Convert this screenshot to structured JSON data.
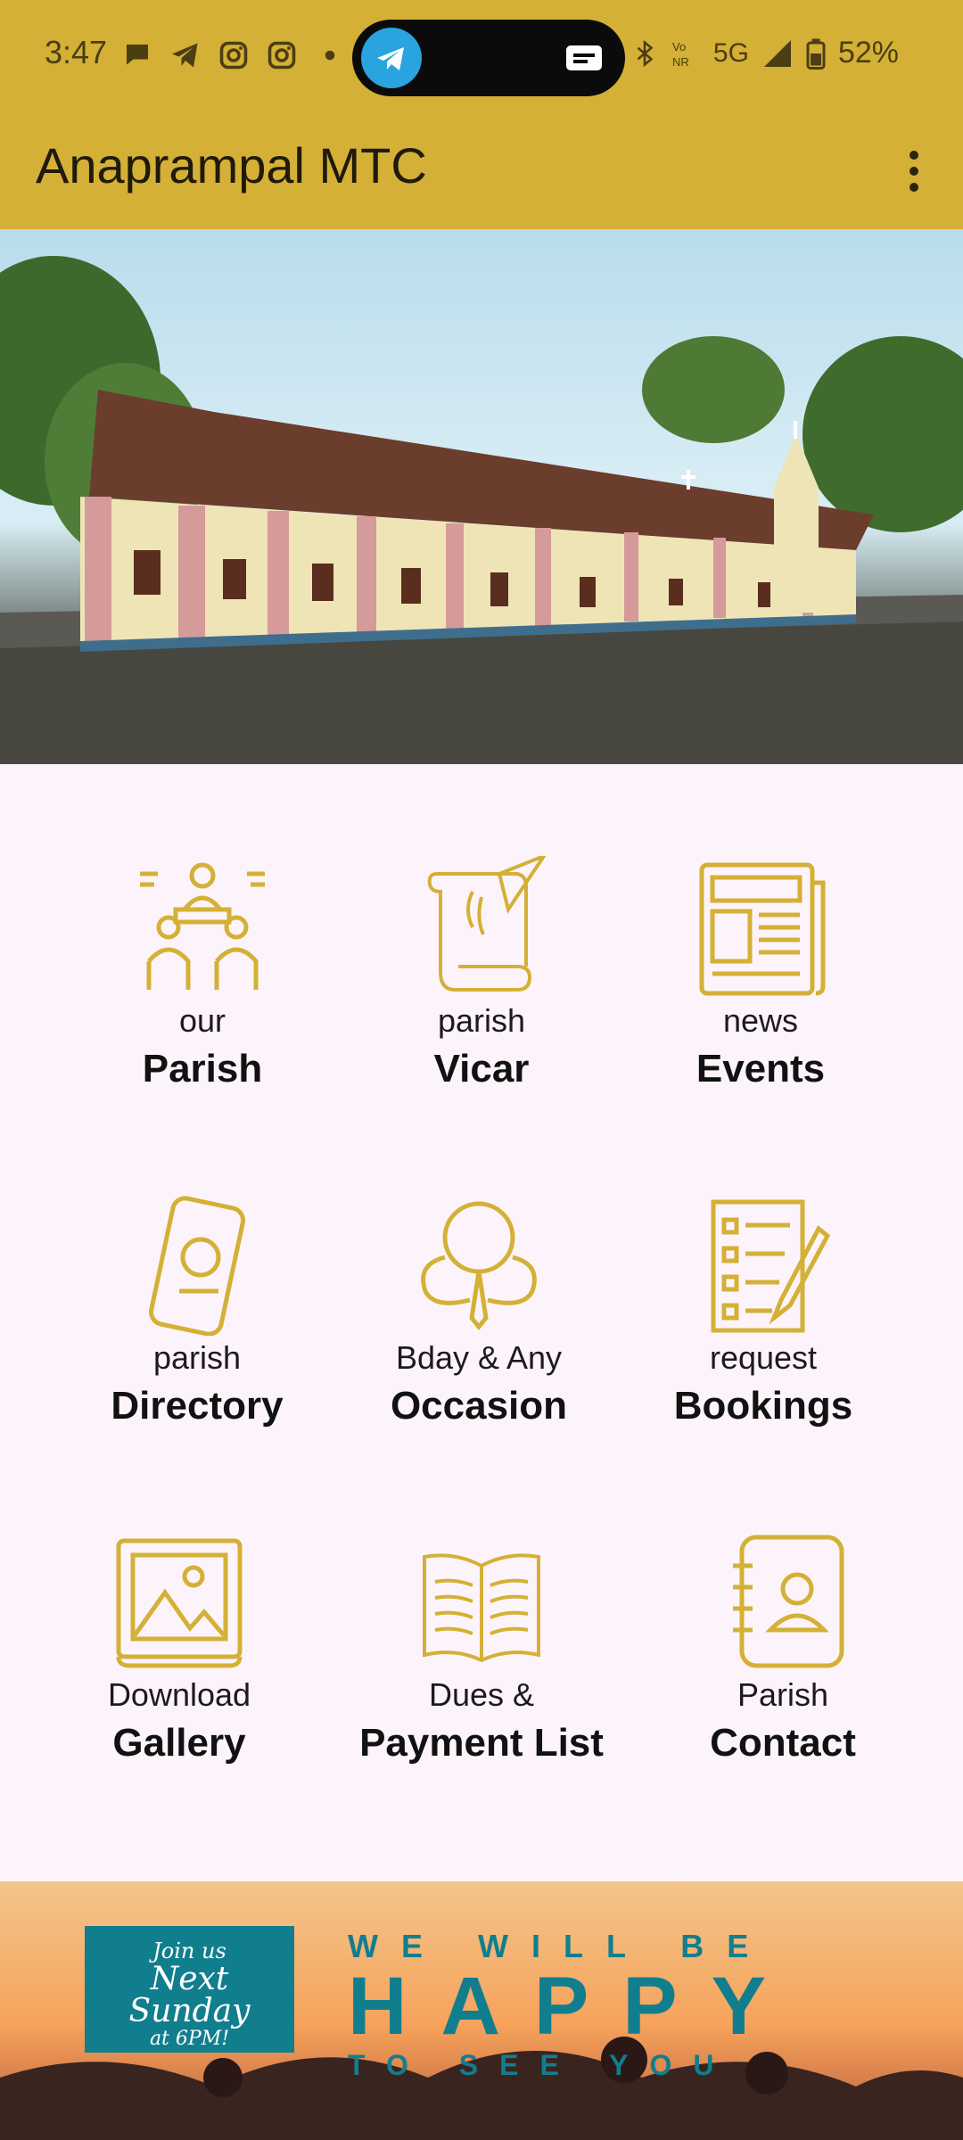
{
  "status_bar": {
    "time": "3:47",
    "battery": "52%",
    "network": "5G"
  },
  "app": {
    "title": "Anaprampal MTC"
  },
  "menu": [
    {
      "small": "our",
      "big": "Parish",
      "icon": "meeting-icon"
    },
    {
      "small": "parish",
      "big": "Vicar",
      "icon": "scroll-quill-icon"
    },
    {
      "small": "news",
      "big": "Events",
      "icon": "newspaper-icon"
    },
    {
      "small": "parish",
      "big": "Directory",
      "icon": "phone-contact-icon"
    },
    {
      "small": "Bday & Any",
      "big": "Occasion",
      "icon": "balloons-icon"
    },
    {
      "small": "request",
      "big": "Bookings",
      "icon": "checklist-pencil-icon"
    },
    {
      "small": "Download",
      "big": "Gallery",
      "icon": "image-gallery-icon"
    },
    {
      "small": "Dues &",
      "big": "Payment List",
      "icon": "open-book-icon"
    },
    {
      "small": "Parish",
      "big": "Contact",
      "icon": "address-book-icon"
    }
  ],
  "banner": {
    "join_line1": "Join us",
    "join_line2": "Next",
    "join_line3": "Sunday",
    "join_line4": "at 6PM!",
    "line1": "WE WILL BE",
    "line2": "HAPPY",
    "line3": "TO SEE YOU"
  },
  "colors": {
    "accent": "#d4b036",
    "icon_gold": "#d4b036",
    "background": "#fdf4fb",
    "banner_teal": "#117e8e"
  }
}
